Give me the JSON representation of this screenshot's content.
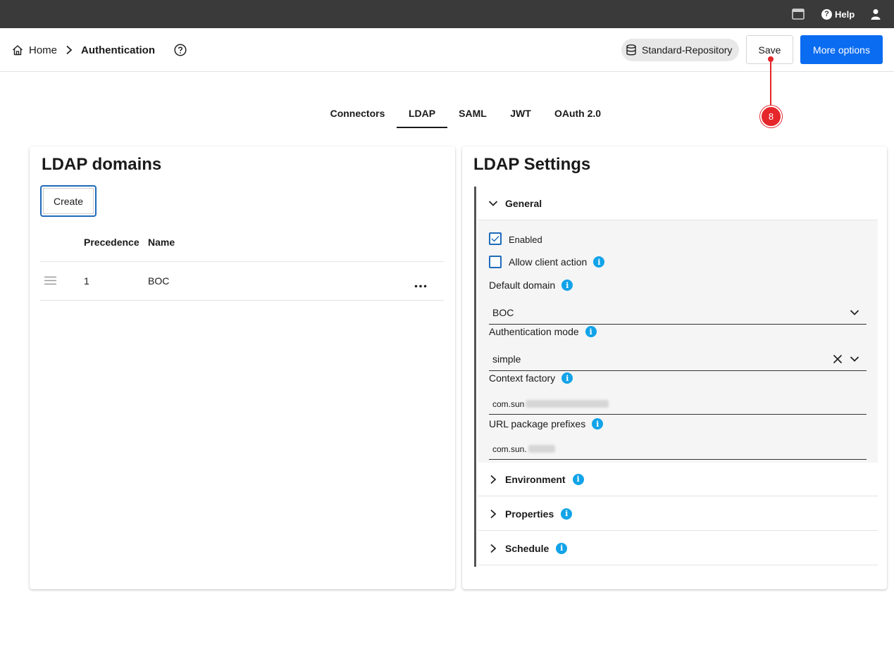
{
  "topbar": {
    "help_label": "Help"
  },
  "breadcrumb": {
    "home": "Home",
    "current": "Authentication"
  },
  "header": {
    "repository": "Standard-Repository",
    "save_label": "Save",
    "more_label": "More options"
  },
  "annotation": {
    "marker": "8"
  },
  "tabs": [
    {
      "label": "Connectors"
    },
    {
      "label": "LDAP"
    },
    {
      "label": "SAML"
    },
    {
      "label": "JWT"
    },
    {
      "label": "OAuth 2.0"
    }
  ],
  "domains_panel": {
    "title": "LDAP domains",
    "create_label": "Create",
    "columns": {
      "precedence": "Precedence",
      "name": "Name"
    },
    "rows": [
      {
        "precedence": "1",
        "name": "BOC"
      }
    ]
  },
  "settings_panel": {
    "title": "LDAP Settings",
    "general": {
      "title": "General",
      "enabled_label": "Enabled",
      "enabled_checked": true,
      "allow_client_label": "Allow client action",
      "allow_client_checked": false,
      "default_domain_label": "Default domain",
      "default_domain_value": "BOC",
      "auth_mode_label": "Authentication mode",
      "auth_mode_value": "simple",
      "context_factory_label": "Context factory",
      "context_factory_value": "com.sun",
      "url_prefixes_label": "URL package prefixes",
      "url_prefixes_value": "com.sun."
    },
    "sections": [
      {
        "title": "Environment"
      },
      {
        "title": "Properties"
      },
      {
        "title": "Schedule"
      }
    ]
  },
  "colors": {
    "accent": "#0a6cf0",
    "info": "#12a3e8",
    "marker": "#e5262a",
    "topbar": "#3a3a3a"
  }
}
